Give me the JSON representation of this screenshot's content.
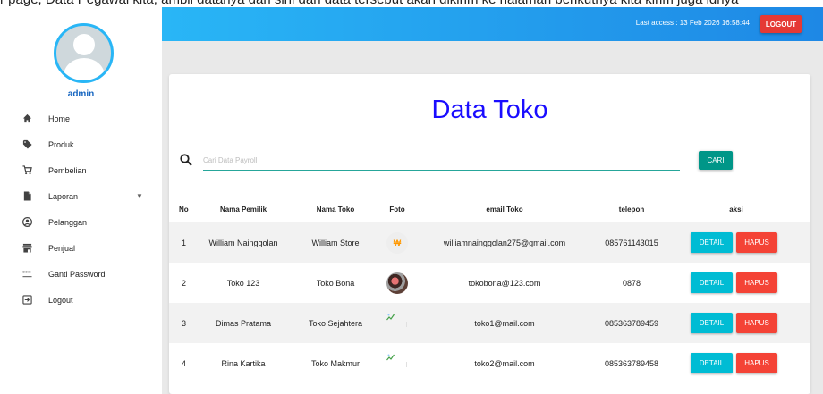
{
  "top_caption": "r page, Data Pegawai kita, ambil datanya dari sini dan data tersebut akan dikirim ke halaman berikutnya kita kirim juga idnya",
  "sidebar": {
    "username": "admin",
    "items": [
      {
        "label": "Home",
        "icon": "home-icon"
      },
      {
        "label": "Produk",
        "icon": "tag-icon"
      },
      {
        "label": "Pembelian",
        "icon": "cart-icon"
      },
      {
        "label": "Laporan",
        "icon": "file-icon",
        "caret": "▼"
      },
      {
        "label": "Pelanggan",
        "icon": "user-circle-icon"
      },
      {
        "label": "Penjual",
        "icon": "store-icon"
      },
      {
        "label": "Ganti Password",
        "icon": "password-icon"
      },
      {
        "label": "Logout",
        "icon": "logout-icon"
      }
    ]
  },
  "header": {
    "last_access": "Last access : 13 Feb 2026 16:58:44",
    "logout_label": "LOGOUT"
  },
  "main": {
    "title": "Data Toko",
    "search_placeholder": "Cari Data Payroll",
    "search_button": "CARI",
    "columns": [
      "No",
      "Nama Pemilik",
      "Nama Toko",
      "Foto",
      "email Toko",
      "telepon",
      "aksi"
    ],
    "detail_label": "DETAIL",
    "hapus_label": "HAPUS",
    "rows": [
      {
        "no": "1",
        "nama_pemilik": "William Nainggolan",
        "nama_toko": "William Store",
        "foto": "logo",
        "email": "williamnainggolan275@gmail.com",
        "telepon": "085761143015"
      },
      {
        "no": "2",
        "nama_pemilik": "Toko 123",
        "nama_toko": "Toko Bona",
        "foto": "photo",
        "email": "tokobona@123.com",
        "telepon": "0878"
      },
      {
        "no": "3",
        "nama_pemilik": "Dimas Pratama",
        "nama_toko": "Toko Sejahtera",
        "foto": "broken",
        "email": "toko1@mail.com",
        "telepon": "085363789459"
      },
      {
        "no": "4",
        "nama_pemilik": "Rina Kartika",
        "nama_toko": "Toko Makmur",
        "foto": "broken",
        "email": "toko2@mail.com",
        "telepon": "085363789458"
      }
    ]
  },
  "colors": {
    "header_start": "#29b6f6",
    "header_end": "#1e88e5",
    "title": "#1a0dff",
    "logout": "#e53935",
    "cari": "#009688",
    "detail": "#00bcd4",
    "hapus": "#f44336"
  }
}
